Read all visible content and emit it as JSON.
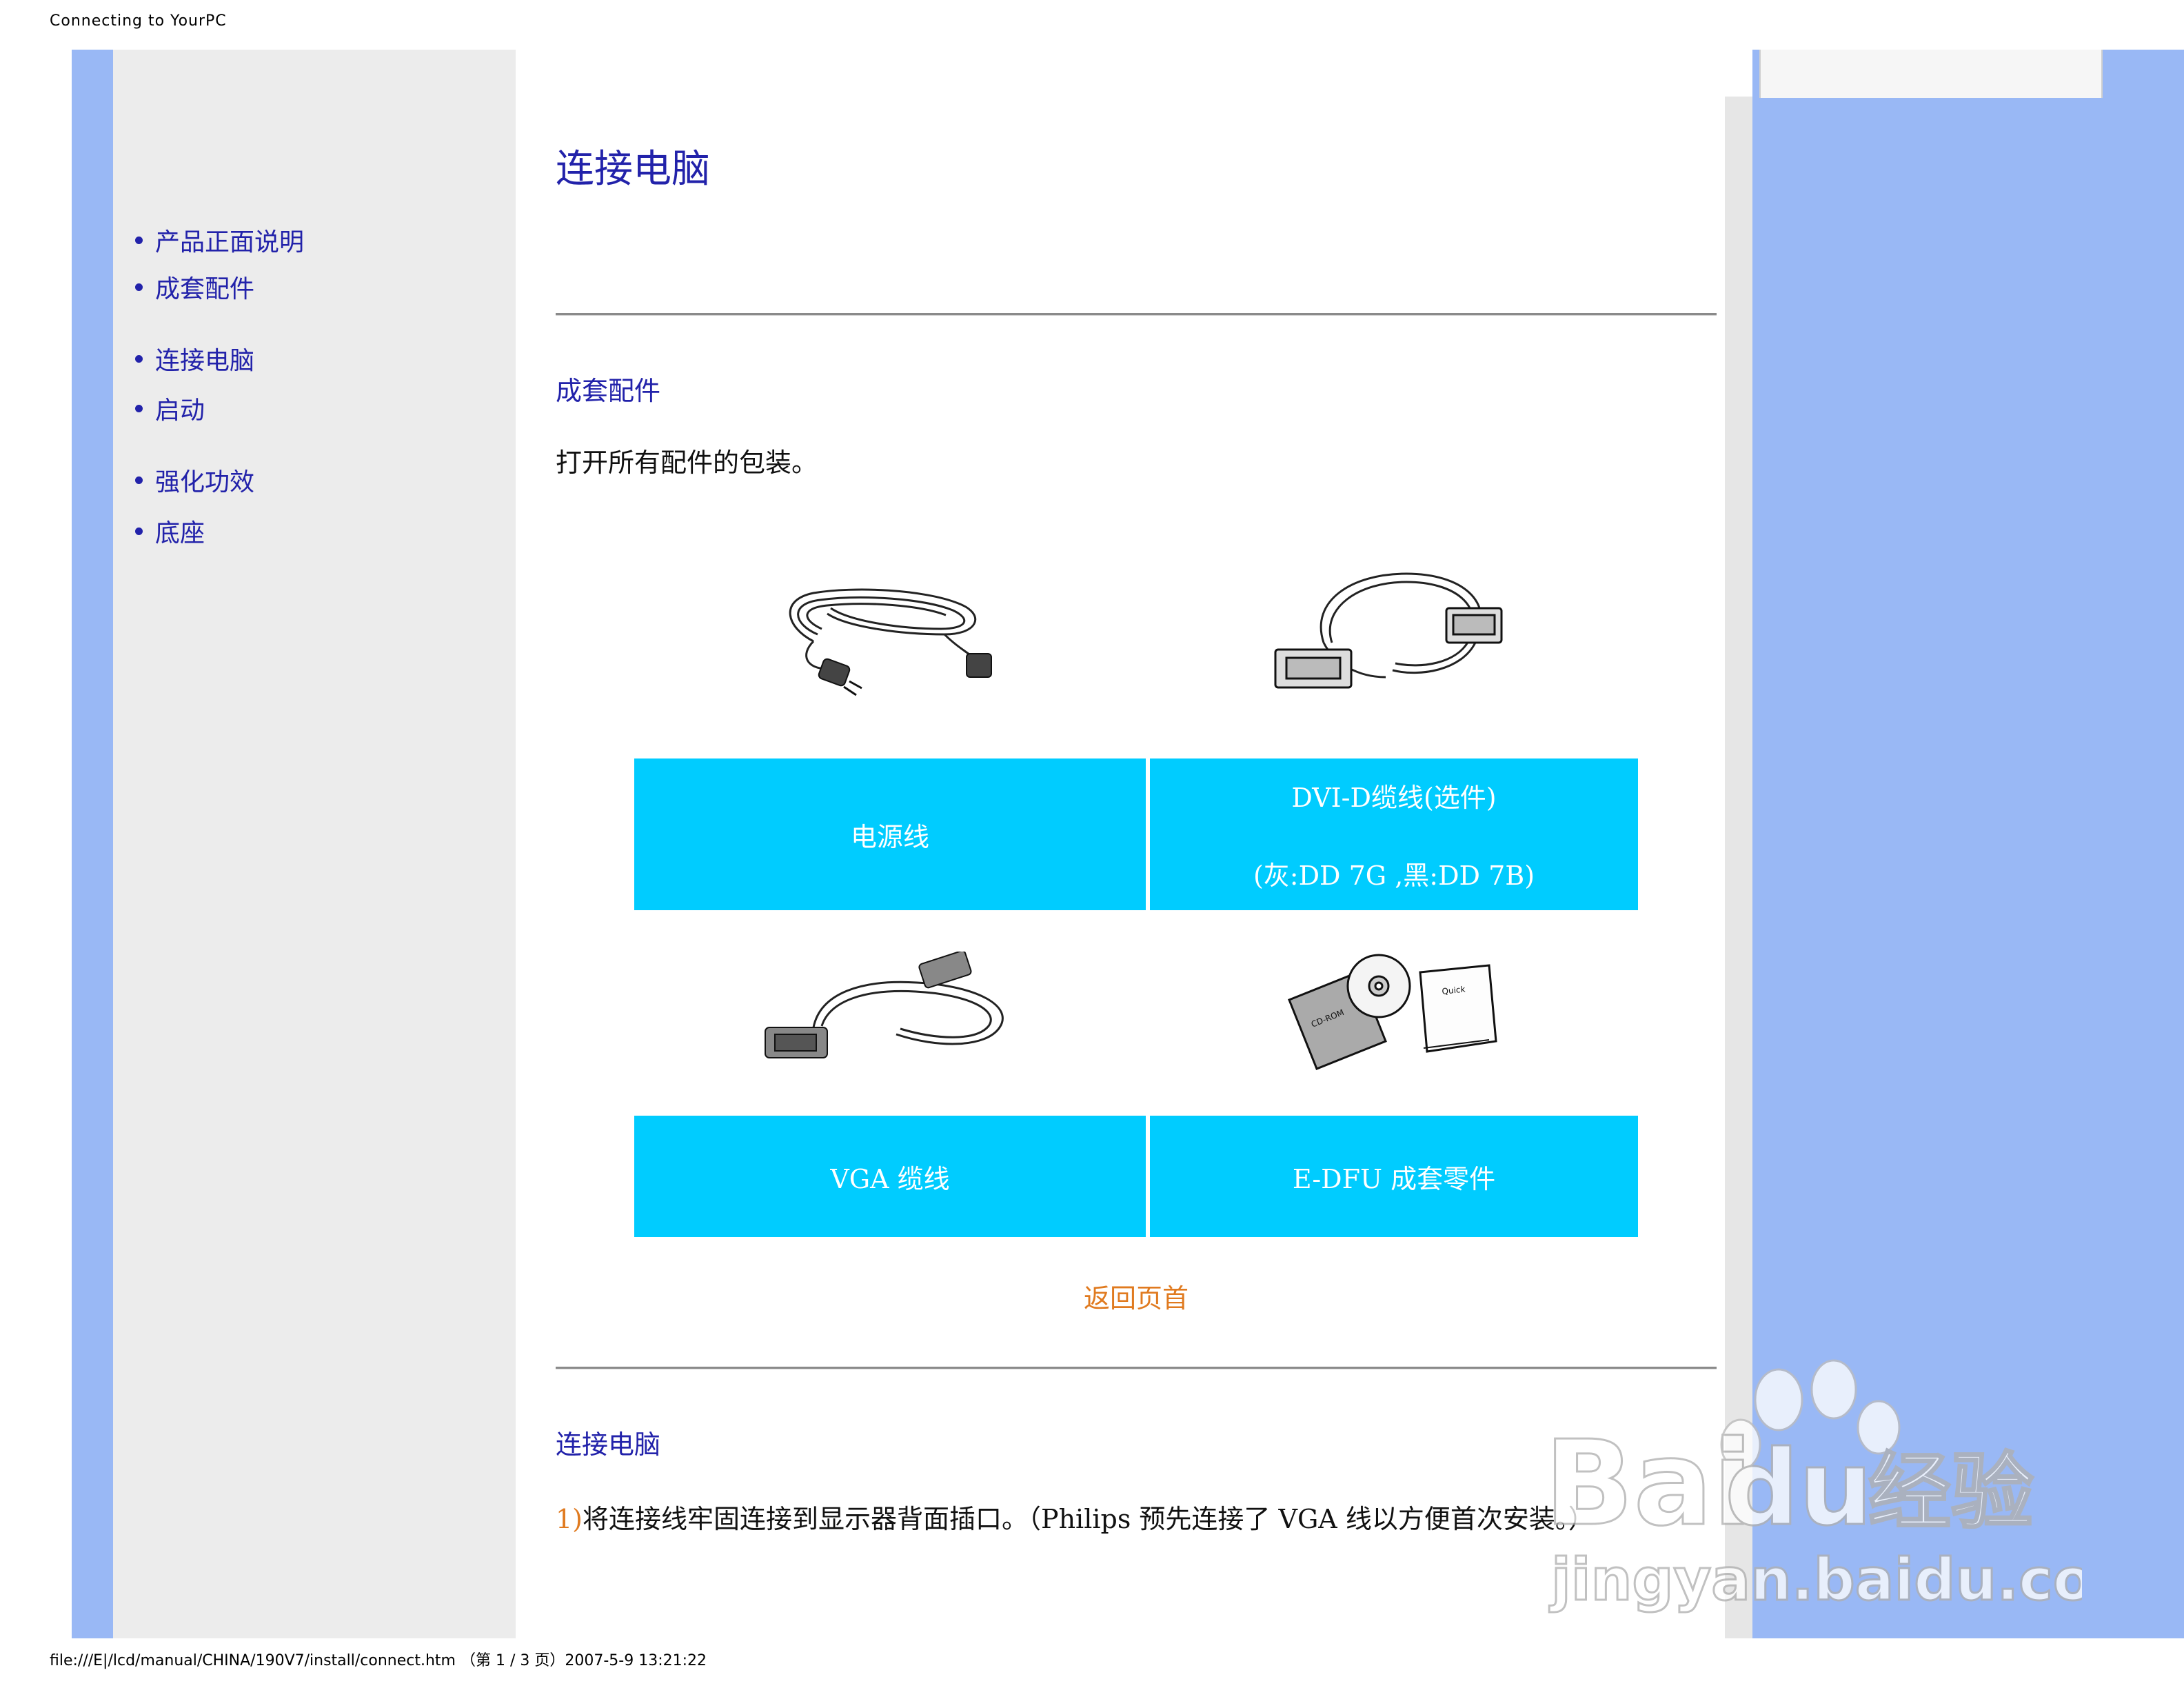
{
  "window": {
    "title": "Connecting to YourPC"
  },
  "nav": {
    "items": [
      {
        "label": "产品正面说明"
      },
      {
        "label": "成套配件"
      },
      {
        "label": "连接电脑"
      },
      {
        "label": "启动"
      },
      {
        "label": "强化功效"
      },
      {
        "label": "底座"
      }
    ]
  },
  "main": {
    "title": "连接电脑",
    "accessories": {
      "heading": "成套配件",
      "intro": "打开所有配件的包装。",
      "items": [
        {
          "label": "电源线",
          "icon": "power-cord-icon"
        },
        {
          "label": "DVI-D缆线(选件)",
          "sub": "(灰:DD 7G ,黑:DD 7B)",
          "icon": "dvi-cable-icon"
        },
        {
          "label": "VGA 缆线",
          "icon": "vga-cable-icon"
        },
        {
          "label": "E-DFU 成套零件",
          "icon": "cd-rom-guide-icon"
        }
      ],
      "cell_color": "#00ccff",
      "back_to_top": "返回页首"
    },
    "connect": {
      "heading": "连接电脑",
      "step_number": "1)",
      "step_text": "将连接线牢固连接到显示器背面插口。（Philips 预先连接了 VGA 线以方便首次安装。）"
    }
  },
  "footer": {
    "url_line": "file:///E|/lcd/manual/CHINA/190V7/install/connect.htm （第 1 / 3 页）2007-5-9 13:21:22"
  },
  "watermark": {
    "brand": "Bai",
    "brand2": "du",
    "cn": "经验",
    "url": "jingyan.baidu.com"
  },
  "colors": {
    "nav_link": "#2222aa",
    "accent_orange": "#e07a1f",
    "side_blue": "#99b8f5"
  }
}
